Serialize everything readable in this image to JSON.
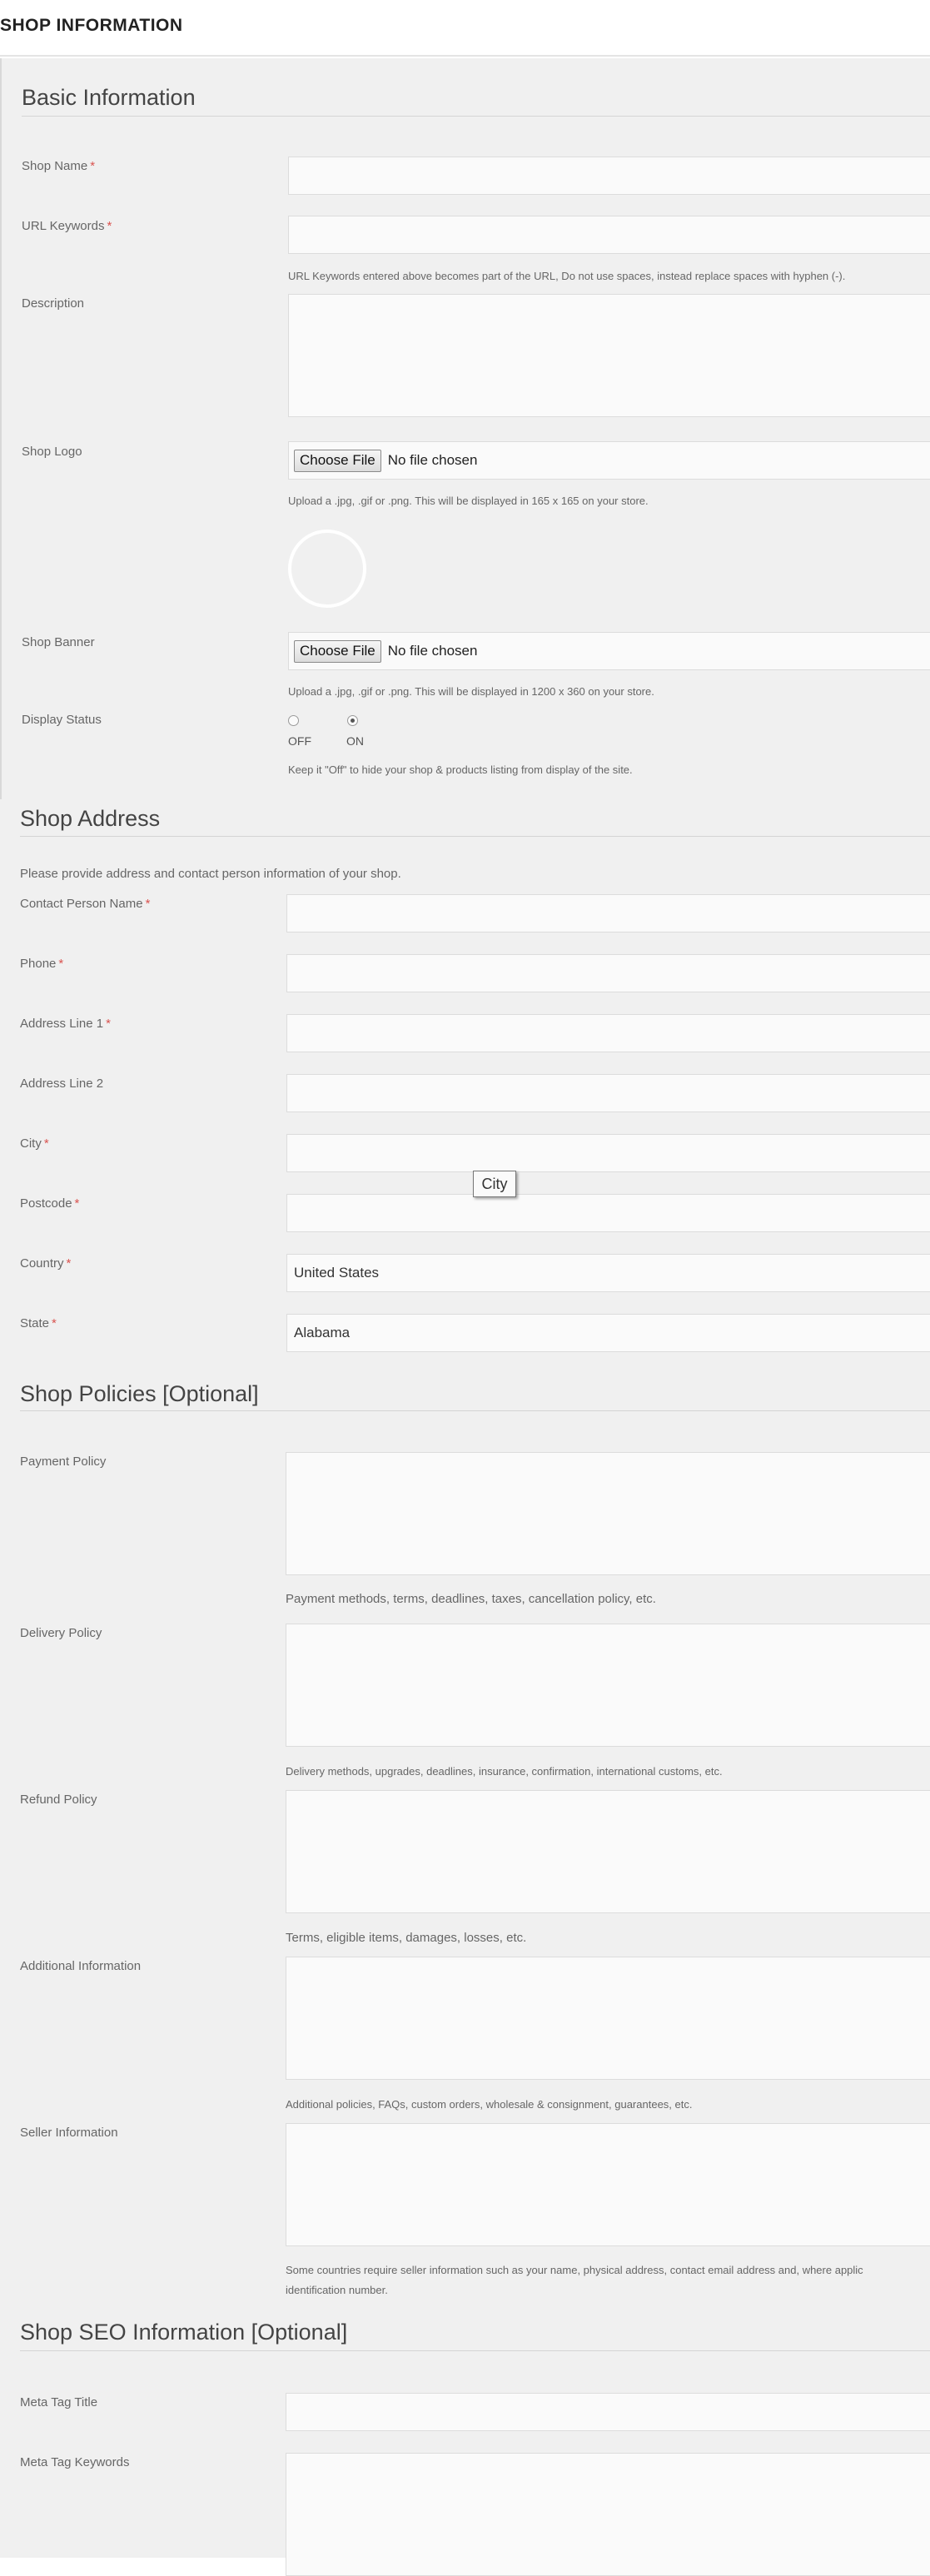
{
  "page": {
    "title": "SHOP INFORMATION"
  },
  "basic": {
    "title": "Basic Information",
    "shop_name": {
      "label": "Shop Name",
      "required": "*",
      "value": ""
    },
    "url_keywords": {
      "label": "URL Keywords",
      "required": "*",
      "value": "",
      "hint": "URL Keywords entered above becomes part of the URL, Do not use spaces, instead replace spaces with hyphen (-)."
    },
    "description": {
      "label": "Description",
      "value": ""
    },
    "shop_logo": {
      "label": "Shop Logo",
      "button": "Choose File",
      "status": "No file chosen",
      "hint": "Upload a .jpg, .gif or .png. This will be displayed in 165 x 165 on your store."
    },
    "shop_banner": {
      "label": "Shop Banner",
      "button": "Choose File",
      "status": "No file chosen",
      "hint": "Upload a .jpg, .gif or .png. This will be displayed in 1200 x 360 on your store."
    },
    "display_status": {
      "label": "Display Status",
      "off_label": "OFF",
      "on_label": "ON",
      "selected": "ON",
      "hint": "Keep it \"Off\" to hide your shop & products listing from display of the site."
    }
  },
  "address": {
    "title": "Shop Address",
    "intro": "Please provide address and contact person information of your shop.",
    "contact_person": {
      "label": "Contact Person Name",
      "required": "*",
      "value": ""
    },
    "phone": {
      "label": "Phone",
      "required": "*",
      "value": ""
    },
    "address1": {
      "label": "Address Line 1",
      "required": "*",
      "value": ""
    },
    "address2": {
      "label": "Address Line 2",
      "value": ""
    },
    "city": {
      "label": "City",
      "required": "*",
      "value": "",
      "tooltip": "City"
    },
    "postcode": {
      "label": "Postcode",
      "required": "*",
      "value": ""
    },
    "country": {
      "label": "Country",
      "required": "*",
      "value": "United States"
    },
    "state": {
      "label": "State",
      "required": "*",
      "value": "Alabama"
    }
  },
  "policies": {
    "title": "Shop Policies [Optional]",
    "payment": {
      "label": "Payment Policy",
      "value": "",
      "hint": "Payment methods, terms, deadlines, taxes, cancellation policy, etc."
    },
    "delivery": {
      "label": "Delivery Policy",
      "value": "",
      "hint": "Delivery methods, upgrades, deadlines, insurance, confirmation, international customs, etc."
    },
    "refund": {
      "label": "Refund Policy",
      "value": "",
      "hint": "Terms, eligible items, damages, losses, etc."
    },
    "additional": {
      "label": "Additional Information",
      "value": "",
      "hint": "Additional policies, FAQs, custom orders, wholesale & consignment, guarantees, etc."
    },
    "seller": {
      "label": "Seller Information",
      "value": "",
      "hint_line1": "Some countries require seller information such as your name, physical address, contact email address and, where applic",
      "hint_line2": "identification number."
    }
  },
  "seo": {
    "title": "Shop SEO Information [Optional]",
    "meta_title": {
      "label": "Meta Tag Title",
      "value": ""
    },
    "meta_keywords": {
      "label": "Meta Tag Keywords",
      "value": ""
    }
  }
}
